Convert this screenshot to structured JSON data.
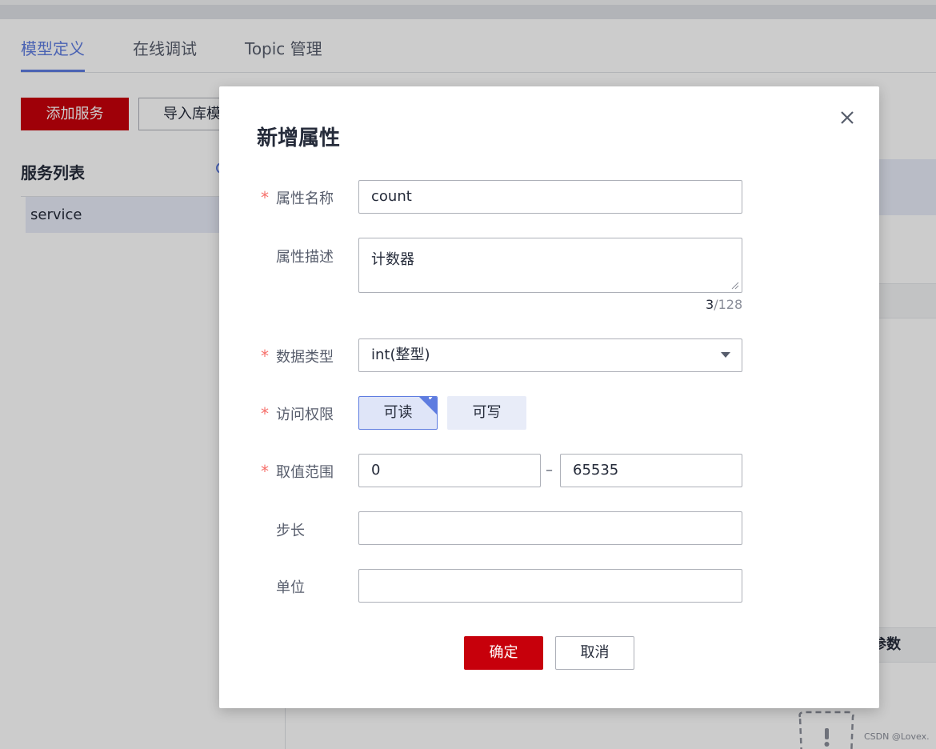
{
  "page": {
    "tabs": [
      {
        "label": "模型定义",
        "active": true
      },
      {
        "label": "在线调试",
        "active": false
      },
      {
        "label": "Topic 管理",
        "active": false
      }
    ],
    "add_service_label": "添加服务",
    "import_label": "导入库模",
    "service_list_title": "服务列表",
    "services": [
      "service"
    ],
    "params_header": "参数",
    "watermark": "CSDN @Lovex."
  },
  "colors": {
    "brand_red": "#c7000b",
    "accent_blue": "#5e7ce0",
    "required_star": "#f66f6a"
  },
  "dialog": {
    "title": "新增属性",
    "close_icon": "close-icon",
    "fields": {
      "name": {
        "label": "属性名称",
        "required": true,
        "value": "count"
      },
      "description": {
        "label": "属性描述",
        "required": false,
        "value": "计数器",
        "count": "3",
        "max": "/128"
      },
      "data_type": {
        "label": "数据类型",
        "required": true,
        "value": "int(整型)"
      },
      "access": {
        "label": "访问权限",
        "required": true,
        "options": [
          "可读",
          "可写"
        ],
        "selected": "可读"
      },
      "range": {
        "label": "取值范围",
        "required": true,
        "min": "0",
        "separator": "–",
        "max": "65535"
      },
      "step": {
        "label": "步长",
        "required": false,
        "value": ""
      },
      "unit": {
        "label": "单位",
        "required": false,
        "value": ""
      }
    },
    "required_mark": "*",
    "confirm_label": "确定",
    "cancel_label": "取消"
  }
}
